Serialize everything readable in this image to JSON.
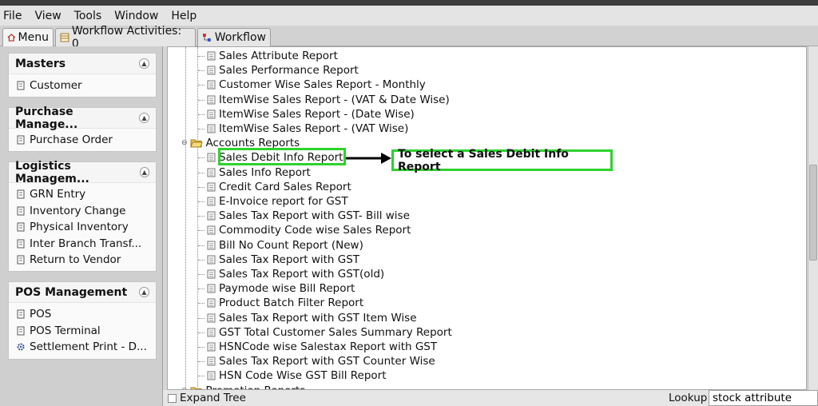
{
  "menubar": {
    "file": "File",
    "view": "View",
    "tools": "Tools",
    "window": "Window",
    "help": "Help"
  },
  "tabs": [
    {
      "label": "Menu",
      "icon": "home-icon"
    },
    {
      "label": "Workflow Activities: 0",
      "icon": "table-icon"
    },
    {
      "label": "Workflow",
      "icon": "workflow-icon"
    }
  ],
  "left_groups": [
    {
      "title": "Masters",
      "items": [
        {
          "label": "Customer",
          "icon": "doc-icon"
        }
      ]
    },
    {
      "title": "Purchase Manage...",
      "items": [
        {
          "label": "Purchase Order",
          "icon": "doc-icon"
        }
      ]
    },
    {
      "title": "Logistics Managem...",
      "items": [
        {
          "label": "GRN Entry",
          "icon": "doc-icon"
        },
        {
          "label": "Inventory Change",
          "icon": "doc-icon"
        },
        {
          "label": "Physical Inventory",
          "icon": "doc-icon"
        },
        {
          "label": "Inter Branch Transf...",
          "icon": "doc-icon"
        },
        {
          "label": "Return to Vendor",
          "icon": "doc-icon"
        }
      ]
    },
    {
      "title": "POS Management",
      "items": [
        {
          "label": "POS",
          "icon": "doc-icon"
        },
        {
          "label": "POS Terminal",
          "icon": "doc-icon"
        },
        {
          "label": "Settlement Print - D...",
          "icon": "gear-icon"
        }
      ]
    }
  ],
  "tree": {
    "sales_items": [
      "Sales Attribute Report",
      "Sales Performance Report",
      "Customer Wise Sales Report - Monthly",
      "ItemWise Sales Report - (VAT & Date Wise)",
      "ItemWise Sales Report - (Date Wise)",
      "ItemWise Sales Report - (VAT Wise)"
    ],
    "accounts_folder": "Accounts Reports",
    "accounts_items": [
      "Sales Debit Info Report",
      "Sales Info Report",
      "Credit Card Sales Report",
      "E-Invoice report for GST",
      "Sales Tax Report with GST- Bill wise",
      "Commodity Code wise Sales Report",
      "Bill No Count Report (New)",
      "Sales Tax Report with GST",
      "Sales Tax Report with GST(old)",
      "Paymode wise Bill Report",
      "Product Batch Filter Report",
      "Sales Tax Report with GST Item Wise",
      "GST Total Customer Sales Summary Report",
      "HSNCode wise Salestax Report with GST",
      "Sales Tax Report with GST Counter Wise",
      "HSN Code Wise GST Bill Report"
    ],
    "next_folder": "Promotion Reports"
  },
  "annotation": {
    "callout_text": "To select  a Sales Debit Info Report",
    "highlight_color": "#2ed22e"
  },
  "statusbar": {
    "expand_label": "Expand Tree",
    "lookup_label": "Lookup",
    "lookup_value": "stock attribute"
  }
}
